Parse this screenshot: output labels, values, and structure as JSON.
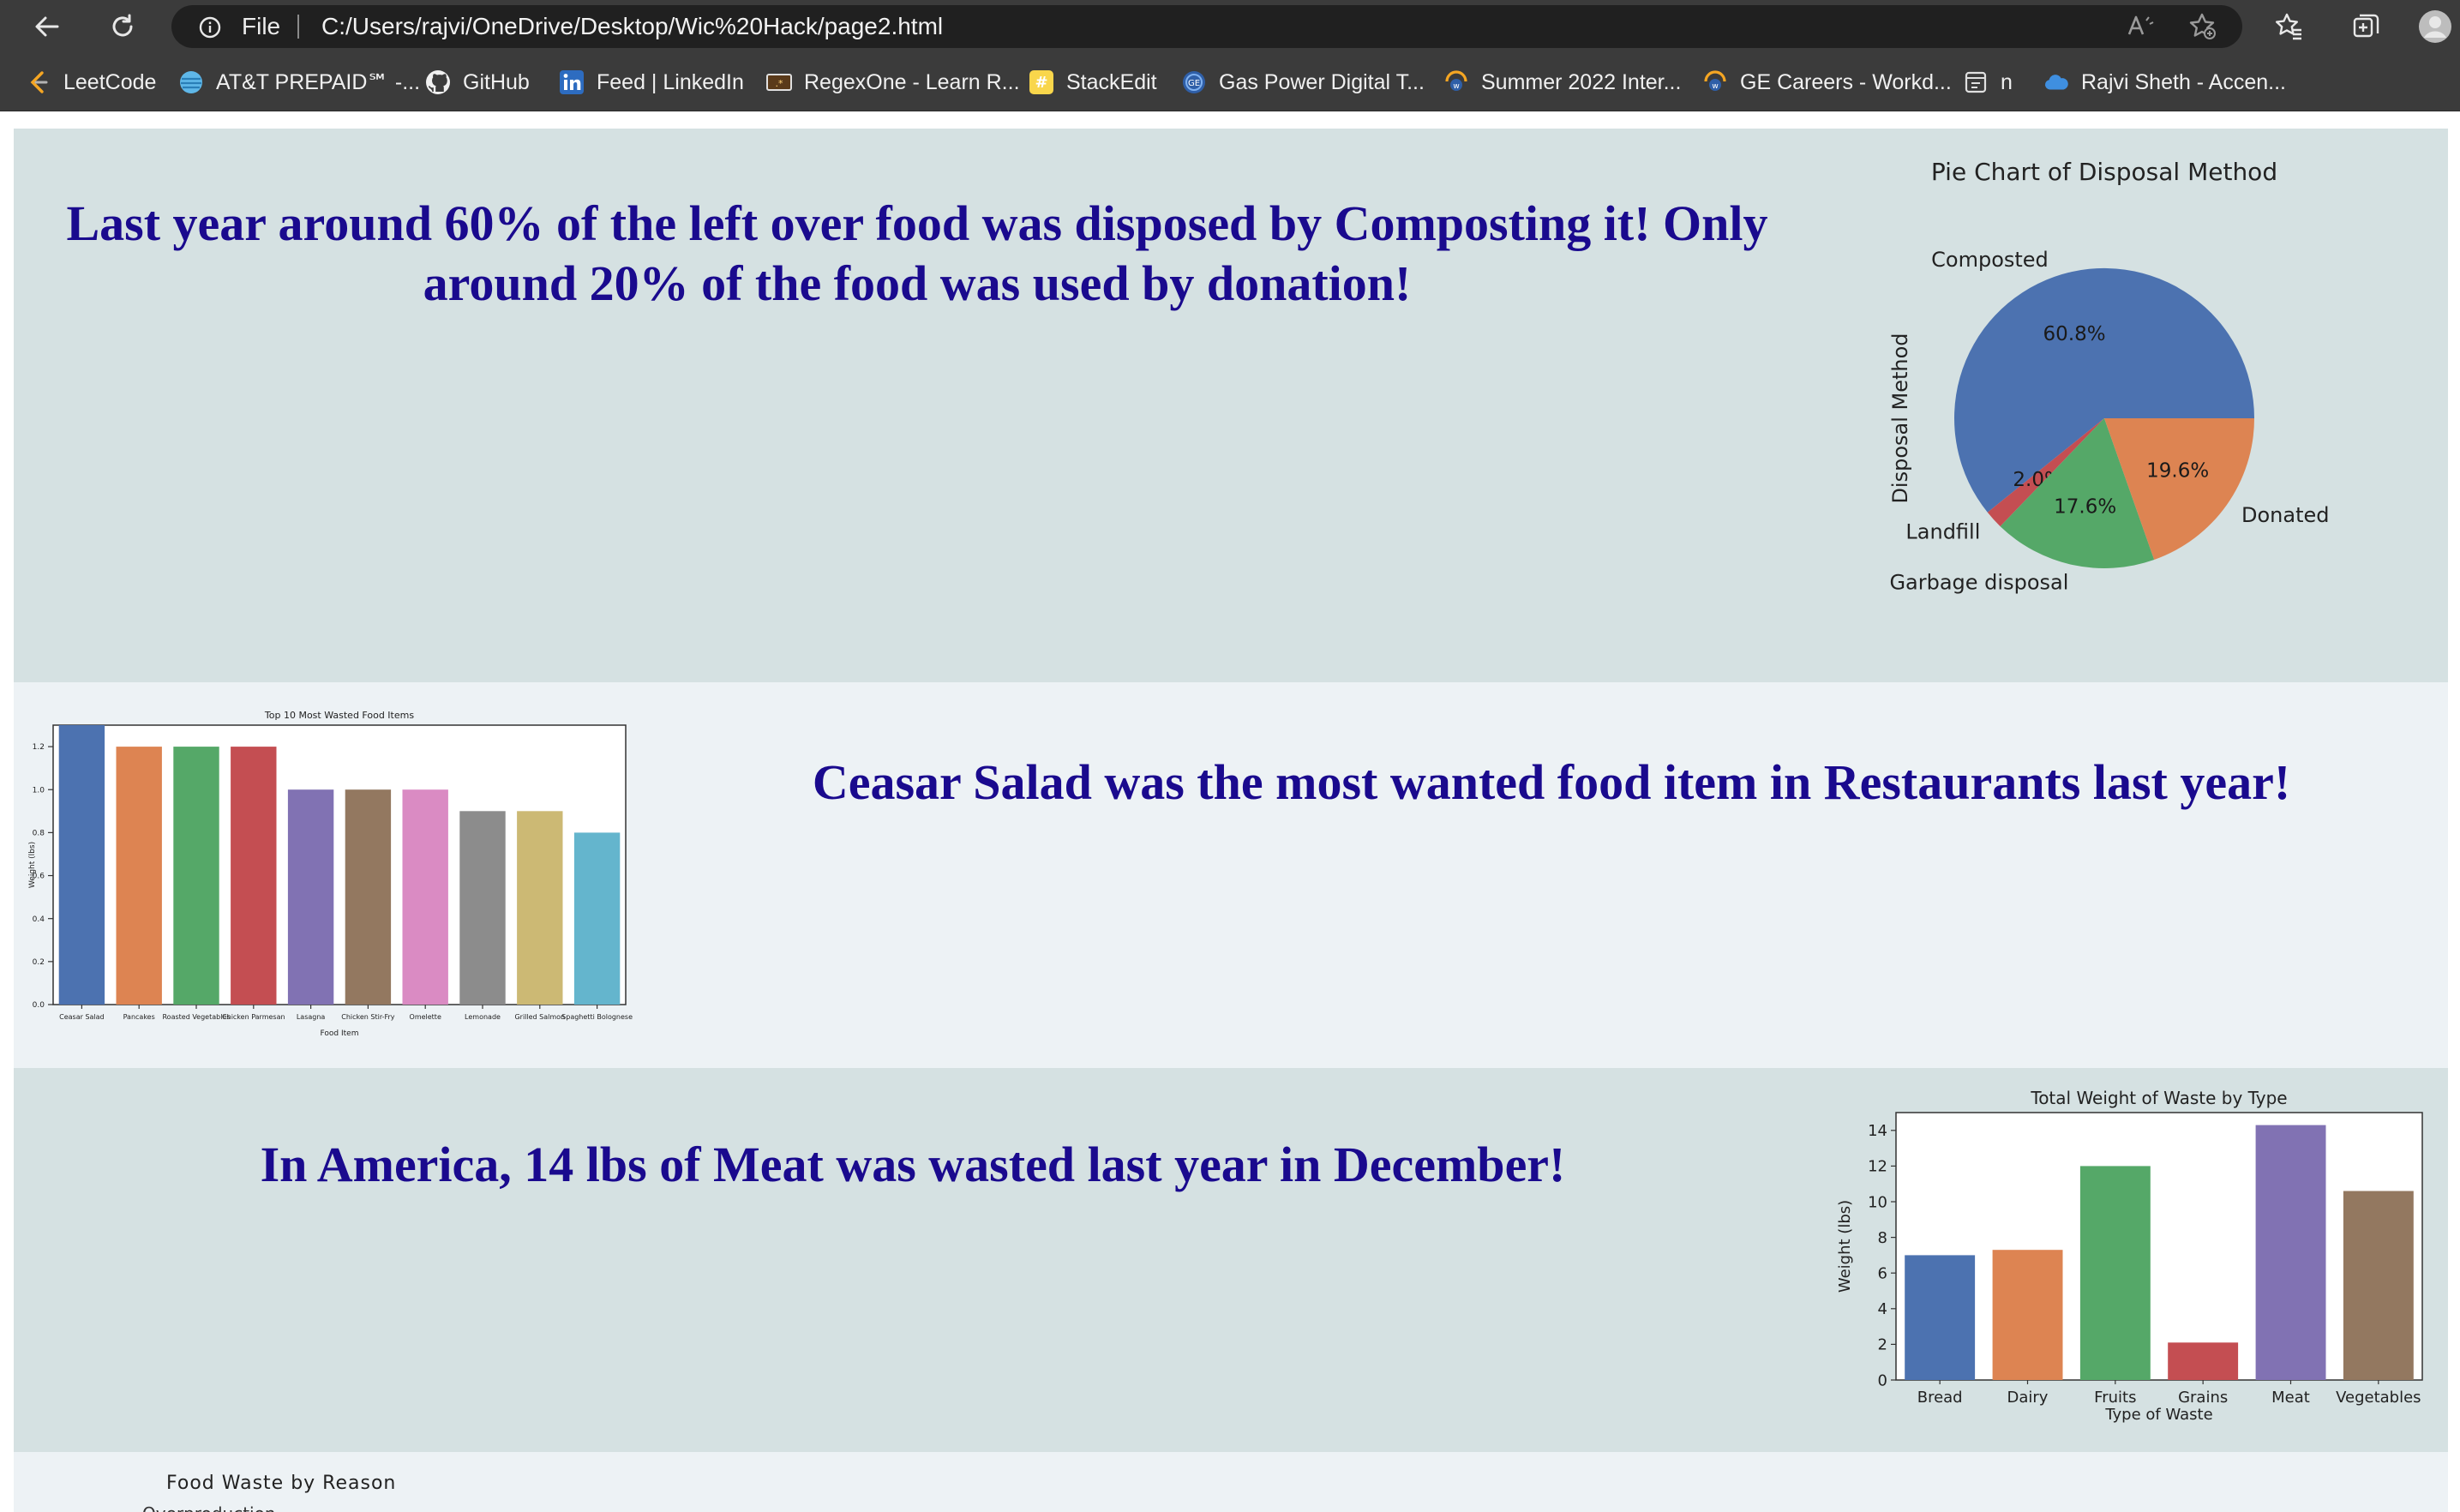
{
  "browser": {
    "address_scheme": "File",
    "address_url": "C:/Users/rajvi/OneDrive/Desktop/Wic%20Hack/page2.html",
    "icons": [
      "back-icon",
      "refresh-icon",
      "info-icon",
      "read-aloud-icon",
      "add-favorite-icon",
      "favorites-icon",
      "collections-icon",
      "profile-icon"
    ]
  },
  "bookmarks": [
    {
      "label": "LeetCode",
      "icon": "leetcode-icon"
    },
    {
      "label": "AT&T PREPAID℠ -...",
      "icon": "att-icon"
    },
    {
      "label": "GitHub",
      "icon": "github-icon"
    },
    {
      "label": "Feed | LinkedIn",
      "icon": "linkedin-icon"
    },
    {
      "label": "RegexOne - Learn R...",
      "icon": "regexone-icon"
    },
    {
      "label": "StackEdit",
      "icon": "stackedit-icon"
    },
    {
      "label": "Gas Power Digital T...",
      "icon": "ge-icon"
    },
    {
      "label": "Summer 2022 Inter...",
      "icon": "workday-icon"
    },
    {
      "label": "GE Careers - Workd...",
      "icon": "workday-icon"
    },
    {
      "label": "n",
      "icon": "page-icon"
    },
    {
      "label": "Rajvi Sheth - Accen...",
      "icon": "cloud-icon"
    }
  ],
  "sections": {
    "disposal_text": "Last year around 60% of the left over food was disposed by Composting it! Only around 20% of the food was used by donation!",
    "wasted_text": "Ceasar Salad was the most wanted food item in Restaurants last year!",
    "meat_text": "In America, 14 lbs of Meat was wasted last year in December!",
    "reason_title": "Food Waste by Reason",
    "reason_partial": "Overproduction"
  },
  "colors": {
    "text_accent": "#1a0a8e",
    "band_a": "#d5e1e2",
    "band_b": "#edf2f5"
  },
  "chart_data": [
    {
      "type": "pie",
      "title": "Pie Chart of Disposal Method",
      "ylabel": "Disposal Method",
      "slices": [
        {
          "label": "Composted",
          "value": 60.8,
          "pct_label": "60.8%",
          "color": "#4c72b0"
        },
        {
          "label": "Landfill",
          "value": 2.0,
          "pct_label": "2.0%",
          "color": "#c44e52"
        },
        {
          "label": "Garbage disposal",
          "value": 17.6,
          "pct_label": "17.6%",
          "color": "#55a868"
        },
        {
          "label": "Donated",
          "value": 19.6,
          "pct_label": "19.6%",
          "color": "#dd8452"
        }
      ]
    },
    {
      "type": "bar",
      "title": "Top 10 Most Wasted Food Items",
      "xlabel": "Food Item",
      "ylabel": "Weight (lbs)",
      "ylim": [
        0,
        1.3
      ],
      "yticks": [
        "0.0",
        "0.2",
        "0.4",
        "0.6",
        "0.8",
        "1.0",
        "1.2"
      ],
      "categories": [
        "Ceasar Salad",
        "Pancakes",
        "Roasted Vegetables",
        "Chicken Parmesan",
        "Lasagna",
        "Chicken Stir-Fry",
        "Omelette",
        "Lemonade",
        "Grilled Salmon",
        "Spaghetti Bolognese"
      ],
      "values": [
        1.3,
        1.2,
        1.2,
        1.2,
        1.0,
        1.0,
        1.0,
        0.9,
        0.9,
        0.8
      ],
      "colors": [
        "#4c72b0",
        "#dd8452",
        "#55a868",
        "#c44e52",
        "#8172b3",
        "#937860",
        "#da8bc3",
        "#8c8c8c",
        "#ccb974",
        "#64b5cd"
      ]
    },
    {
      "type": "bar",
      "title": "Total Weight of Waste by Type",
      "xlabel": "Type of Waste",
      "ylabel": "Weight (lbs)",
      "ylim": [
        0,
        15
      ],
      "yticks": [
        "0",
        "2",
        "4",
        "6",
        "8",
        "10",
        "12",
        "14"
      ],
      "categories": [
        "Bread",
        "Dairy",
        "Fruits",
        "Grains",
        "Meat",
        "Vegetables"
      ],
      "values": [
        7.0,
        7.3,
        12.0,
        2.1,
        14.3,
        10.6
      ],
      "colors": [
        "#4c72b0",
        "#dd8452",
        "#55a868",
        "#c44e52",
        "#8172b3",
        "#937860"
      ]
    }
  ]
}
